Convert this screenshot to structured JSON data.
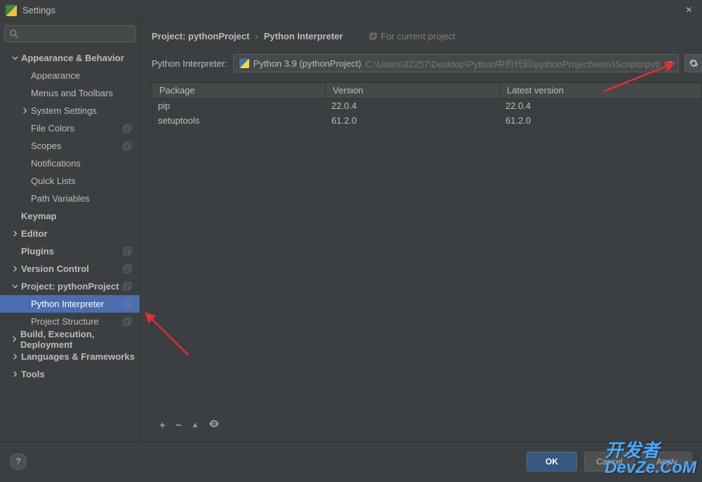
{
  "window": {
    "title": "Settings"
  },
  "search": {
    "placeholder": ""
  },
  "sidebar": {
    "items": [
      {
        "label": "Appearance & Behavior",
        "top": true,
        "expanded": true
      },
      {
        "label": "Appearance",
        "child": true
      },
      {
        "label": "Menus and Toolbars",
        "child": true
      },
      {
        "label": "System Settings",
        "child": true,
        "expandable": true
      },
      {
        "label": "File Colors",
        "child": true,
        "trail": true
      },
      {
        "label": "Scopes",
        "child": true,
        "trail": true
      },
      {
        "label": "Notifications",
        "child": true
      },
      {
        "label": "Quick Lists",
        "child": true
      },
      {
        "label": "Path Variables",
        "child": true
      },
      {
        "label": "Keymap",
        "top": true
      },
      {
        "label": "Editor",
        "top": true,
        "expandable": true
      },
      {
        "label": "Plugins",
        "top": true,
        "trail": true
      },
      {
        "label": "Version Control",
        "top": true,
        "expandable": true,
        "trail": true
      },
      {
        "label": "Project: pythonProject",
        "top": true,
        "expanded": true,
        "trail": true
      },
      {
        "label": "Python Interpreter",
        "child": true,
        "selected": true,
        "trail": true
      },
      {
        "label": "Project Structure",
        "child": true,
        "trail": true
      },
      {
        "label": "Build, Execution, Deployment",
        "top": true,
        "expandable": true
      },
      {
        "label": "Languages & Frameworks",
        "top": true,
        "expandable": true
      },
      {
        "label": "Tools",
        "top": true,
        "expandable": true
      }
    ]
  },
  "breadcrumb": {
    "part1": "Project: pythonProject",
    "sep": "›",
    "part2": "Python Interpreter",
    "badge": "For current project"
  },
  "interpreter": {
    "label": "Python Interpreter:",
    "selected_name": "Python 3.9 (pythonProject)",
    "selected_path": "C:\\Users\\32257\\Desktop\\Python中的代码\\pythonProject\\venv\\Scripts\\pytl"
  },
  "packages": {
    "columns": [
      "Package",
      "Version",
      "Latest version"
    ],
    "rows": [
      {
        "name": "pip",
        "version": "22.0.4",
        "latest": "22.0.4"
      },
      {
        "name": "setuptools",
        "version": "61.2.0",
        "latest": "61.2.0"
      }
    ]
  },
  "toolbar": {
    "add": "+",
    "remove": "−",
    "up": "▲",
    "eye": "◉"
  },
  "buttons": {
    "ok": "OK",
    "cancel": "Cancel",
    "apply": "Apply",
    "help": "?"
  },
  "watermark": {
    "cn": "开发者",
    "en": "DevZe.CoM"
  }
}
